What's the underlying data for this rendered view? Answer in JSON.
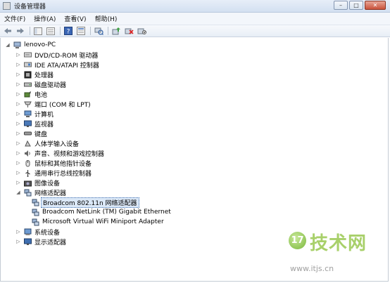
{
  "window": {
    "title": "设备管理器",
    "controls": [
      "–",
      "□",
      "✕"
    ]
  },
  "menu": [
    "文件(F)",
    "操作(A)",
    "查看(V)",
    "帮助(H)"
  ],
  "tree": {
    "root": "lenovo-PC",
    "categories": [
      {
        "label": "DVD/CD-ROM 驱动器",
        "icon": "disc-drive-icon",
        "expanded": false
      },
      {
        "label": "IDE ATA/ATAPI 控制器",
        "icon": "ide-controller-icon",
        "expanded": false
      },
      {
        "label": "处理器",
        "icon": "processor-icon",
        "expanded": false
      },
      {
        "label": "磁盘驱动器",
        "icon": "disk-drive-icon",
        "expanded": false
      },
      {
        "label": "电池",
        "icon": "battery-icon",
        "expanded": false
      },
      {
        "label": "端口 (COM 和 LPT)",
        "icon": "port-icon",
        "expanded": false
      },
      {
        "label": "计算机",
        "icon": "computer-icon",
        "expanded": false
      },
      {
        "label": "监视器",
        "icon": "monitor-icon",
        "expanded": false
      },
      {
        "label": "键盘",
        "icon": "keyboard-icon",
        "expanded": false
      },
      {
        "label": "人体学输入设备",
        "icon": "hid-icon",
        "expanded": false
      },
      {
        "label": "声音、视频和游戏控制器",
        "icon": "sound-icon",
        "expanded": false
      },
      {
        "label": "鼠标和其他指针设备",
        "icon": "mouse-icon",
        "expanded": false
      },
      {
        "label": "通用串行总线控制器",
        "icon": "usb-icon",
        "expanded": false
      },
      {
        "label": "图像设备",
        "icon": "imaging-icon",
        "expanded": false
      },
      {
        "label": "网络适配器",
        "icon": "network-adapter-icon",
        "expanded": true,
        "children": [
          "Broadcom 802.11n 网络适配器",
          "Broadcom NetLink (TM) Gigabit Ethernet",
          "Microsoft Virtual WiFi Miniport Adapter"
        ]
      },
      {
        "label": "系统设备",
        "icon": "system-device-icon",
        "expanded": false
      },
      {
        "label": "显示适配器",
        "icon": "display-adapter-icon",
        "expanded": false
      }
    ],
    "selected_child": "Broadcom 802.11n 网络适配器"
  },
  "watermark": {
    "badge": "17",
    "text": "技术网",
    "url": "www.itjs.cn"
  }
}
